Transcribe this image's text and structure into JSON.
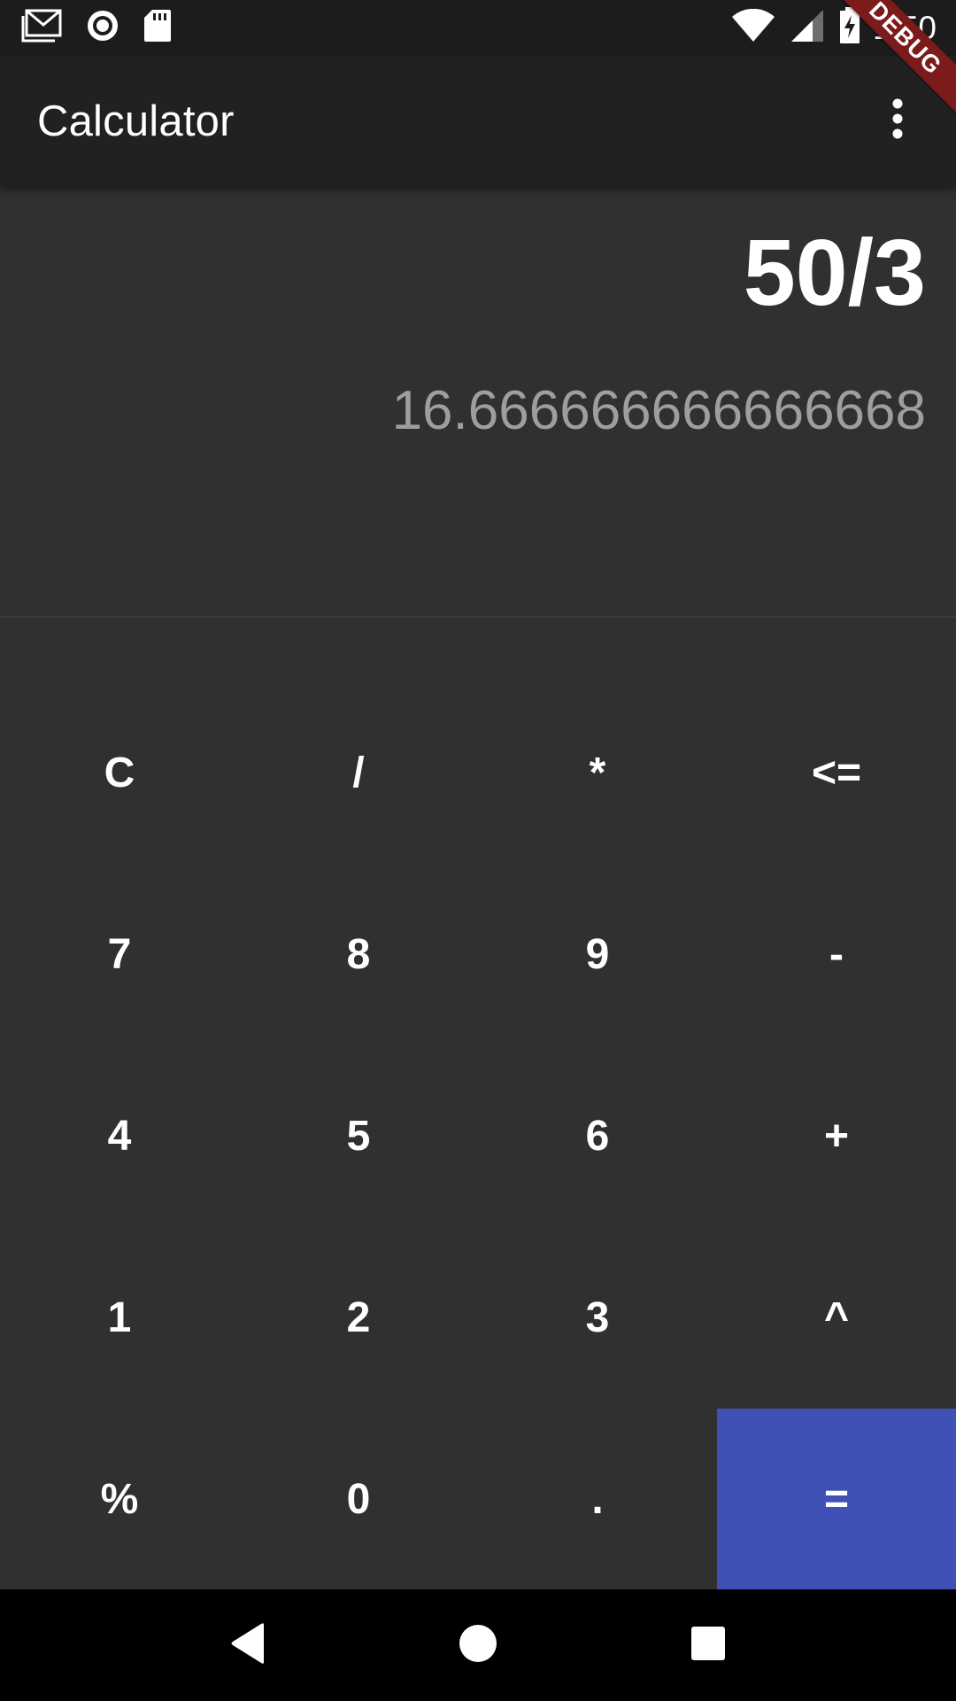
{
  "status_bar": {
    "time": "1:50",
    "left_icons": [
      "gmail-icon",
      "record-icon",
      "sd-card-icon"
    ],
    "right_icons": [
      "wifi-icon",
      "cell-signal-icon",
      "battery-charging-icon"
    ]
  },
  "app_bar": {
    "title": "Calculator",
    "overflow_icon": "more-vert-icon"
  },
  "debug_banner": "DEBUG",
  "display": {
    "expression": "50/3",
    "result": "16.666666666666668"
  },
  "keypad": {
    "keys": [
      [
        "C",
        "/",
        "*",
        "<="
      ],
      [
        "7",
        "8",
        "9",
        "-"
      ],
      [
        "4",
        "5",
        "6",
        "+"
      ],
      [
        "1",
        "2",
        "3",
        "^"
      ],
      [
        "%",
        "0",
        ".",
        "="
      ]
    ]
  },
  "nav_bar": {
    "icons": [
      "back-icon",
      "home-icon",
      "recents-icon"
    ]
  },
  "colors": {
    "background": "#303030",
    "app_bar": "#212121",
    "status_bar": "#1c1c1c",
    "equals_accent": "#3f51b5",
    "result_text": "#9e9e9e",
    "debug_ribbon": "#7b1b1b"
  }
}
